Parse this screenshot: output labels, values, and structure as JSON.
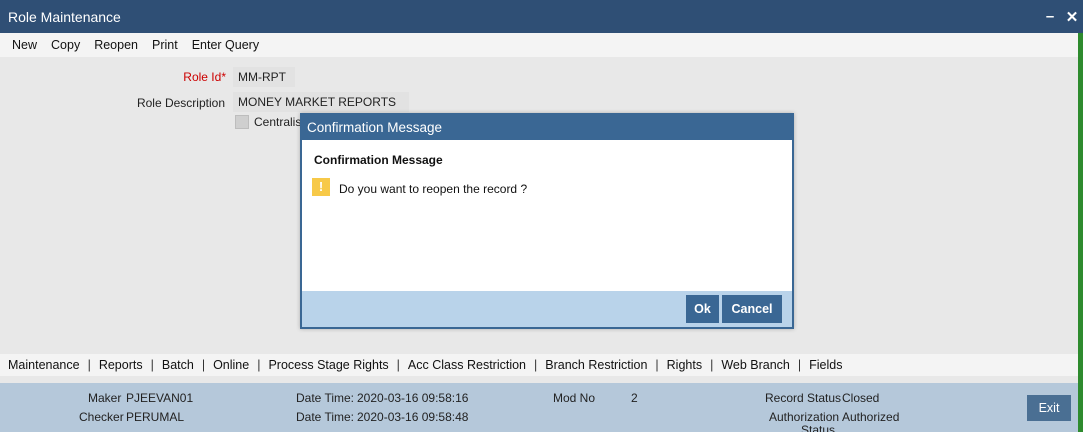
{
  "window": {
    "title": "Role Maintenance",
    "minimize_label": "–",
    "close_label": "✕"
  },
  "menu": {
    "items": [
      "New",
      "Copy",
      "Reopen",
      "Print",
      "Enter Query"
    ]
  },
  "form": {
    "role_id_label": "Role Id",
    "required_mark": "*",
    "role_id_value": "MM-RPT",
    "role_desc_label": "Role Description",
    "role_desc_value": "MONEY MARKET REPORTS",
    "centralised_label": "Centralis"
  },
  "dialog": {
    "title": "Confirmation Message",
    "heading": "Confirmation Message",
    "icon": "!",
    "message": "Do you want to reopen the record ?",
    "ok_label": "Ok",
    "cancel_label": "Cancel"
  },
  "tabs": [
    "Maintenance",
    "Reports",
    "Batch",
    "Online",
    "Process Stage Rights",
    "Acc Class Restriction",
    "Branch Restriction",
    "Rights",
    "Web Branch",
    "Fields"
  ],
  "status": {
    "maker_label": "Maker",
    "maker_value": "PJEEVAN01",
    "checker_label": "Checker",
    "checker_value": "PERUMAL",
    "maker_dt_label": "Date Time:",
    "maker_dt_value": "2020-03-16 09:58:16",
    "checker_dt_label": "Date Time:",
    "checker_dt_value": "2020-03-16 09:58:48",
    "mod_no_label": "Mod No",
    "mod_no_value": "2",
    "record_status_label": "Record Status",
    "record_status_value": "Closed",
    "auth_status_label_1": "Authorization",
    "auth_status_label_2": "Status",
    "auth_status_value": "Authorized",
    "exit_label": "Exit"
  },
  "colors": {
    "titlebar": "#2f4f75",
    "dialog_accent": "#3a6794",
    "status_bg": "#b5c8da",
    "right_border": "#2e8b2e",
    "warning": "#f7c948"
  }
}
